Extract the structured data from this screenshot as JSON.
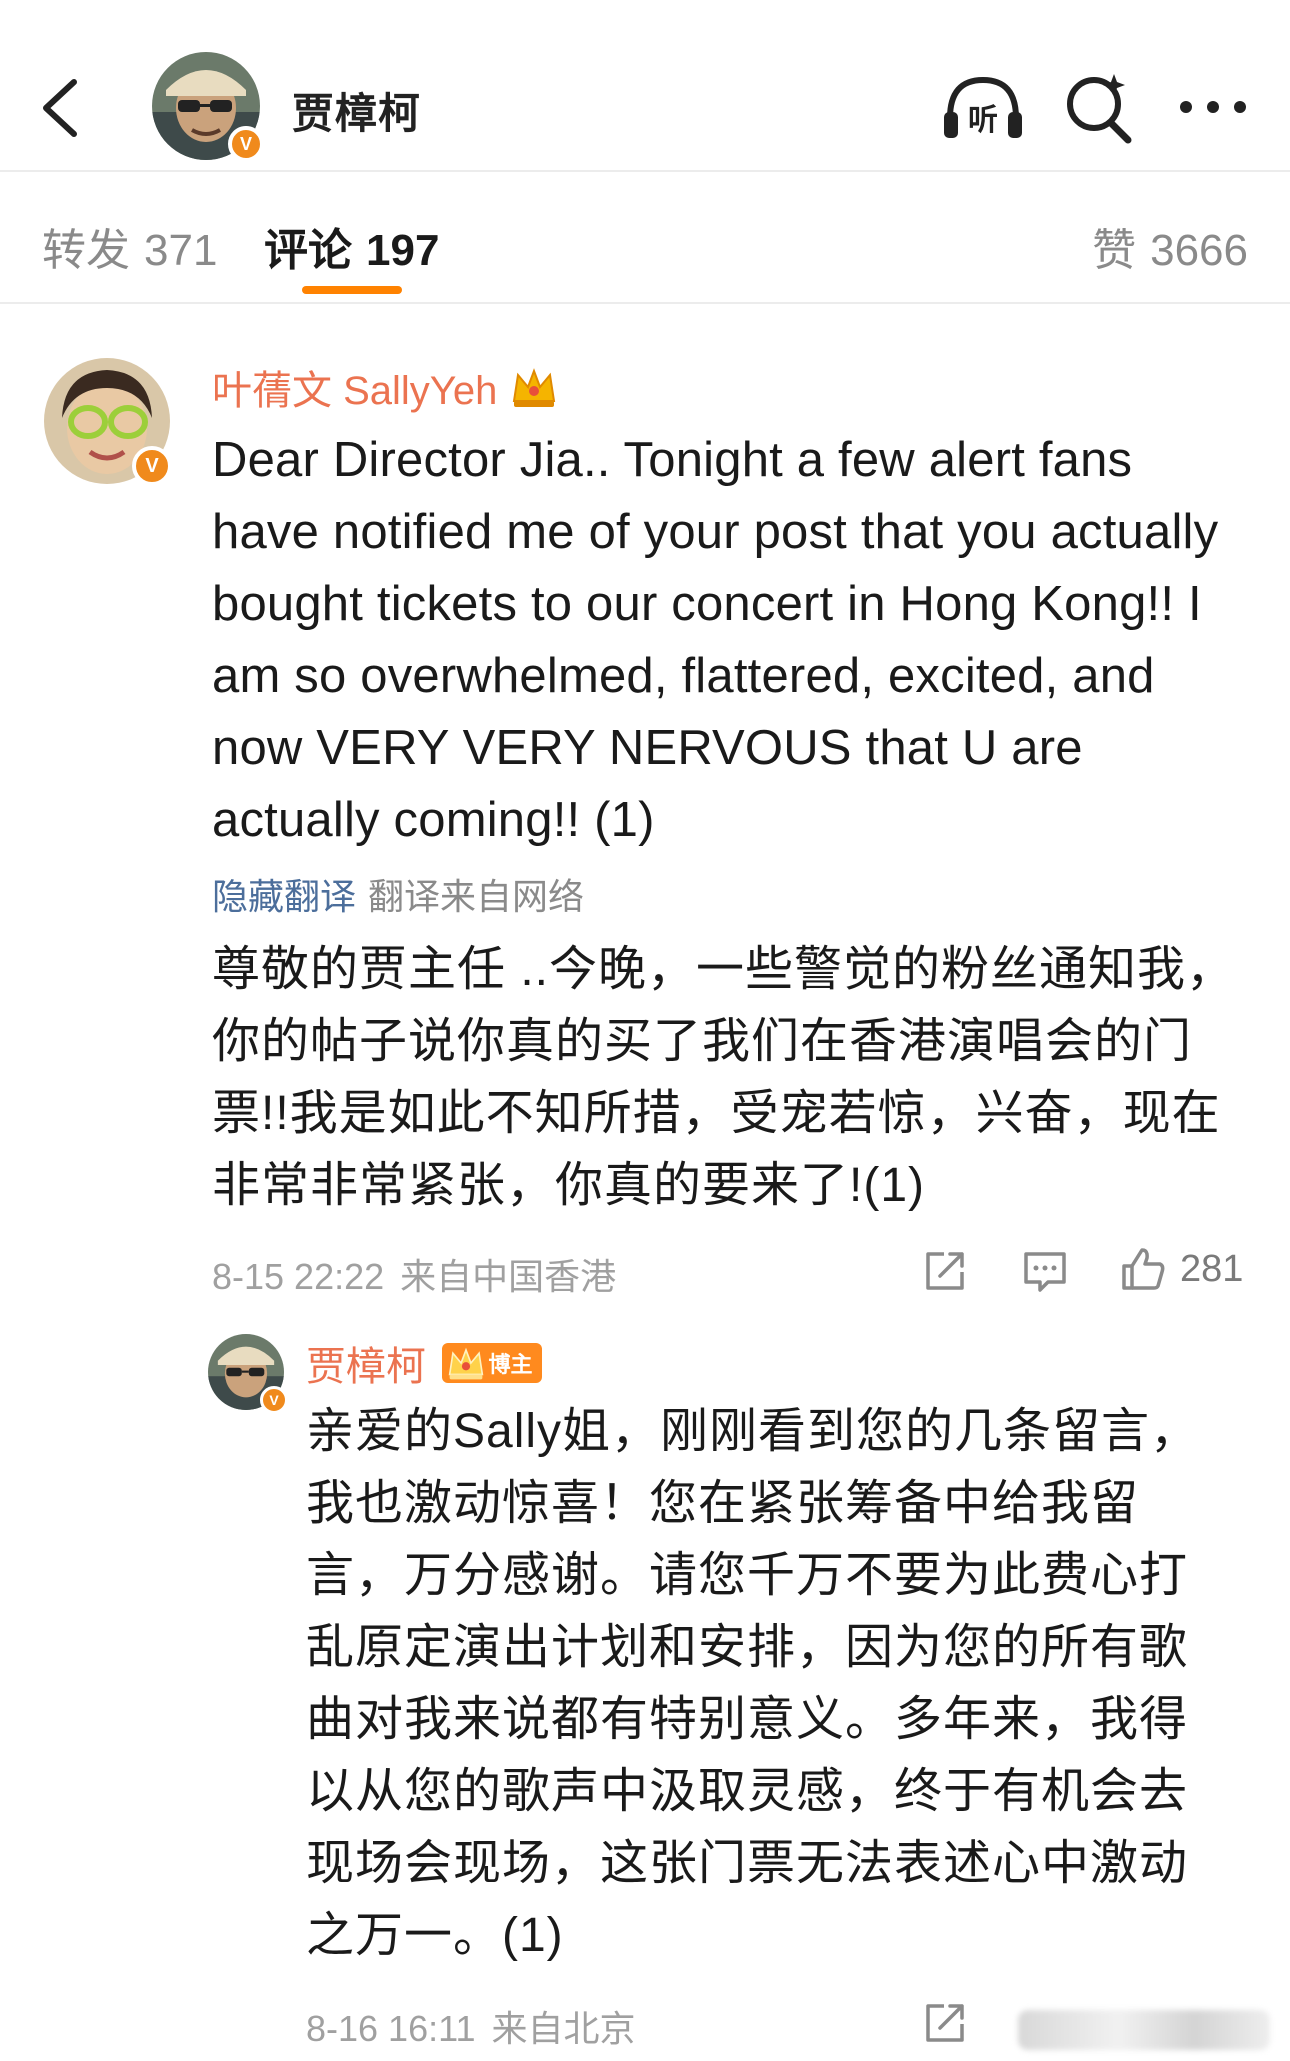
{
  "header": {
    "username": "贾樟柯",
    "verified_badge": "V",
    "icons": [
      "back-icon",
      "listen-icon",
      "search-icon",
      "more-icon"
    ],
    "listen_label": "听"
  },
  "tabs": [
    {
      "label": "转发",
      "count": "371",
      "active": false
    },
    {
      "label": "评论",
      "count": "197",
      "active": true
    },
    {
      "label": "赞",
      "count": "3666",
      "active": false
    }
  ],
  "colors": {
    "accent": "#ff8200",
    "username": "#eb7350",
    "link": "#4c6e9b",
    "meta": "#a0a0a0"
  },
  "comment": {
    "author": "叶蒨文 SallyYeh",
    "verified_badge": "V",
    "text": "Dear Director Jia.. Tonight a few alert fans have notified me of your post that you actually bought tickets to our concert in Hong Kong!!  I am so overwhelmed, flattered, excited, and now VERY VERY NERVOUS that U are actually coming!! (1)",
    "hide_translation": "隐藏翻译",
    "translation_source": "翻译来自网络",
    "translation": "尊敬的贾主任 ..今晚，一些警觉的粉丝通知我，你的帖子说你真的买了我们在香港演唱会的门票!!我是如此不知所措，受宠若惊，兴奋，现在非常非常紧张，你真的要来了!(1)",
    "time": "8-15 22:22",
    "location": "来自中国香港",
    "likes": "281"
  },
  "reply": {
    "author": "贾樟柯",
    "verified_badge": "V",
    "author_badge": "博主",
    "text": "亲爱的Sally姐，刚刚看到您的几条留言，我也激动惊喜！您在紧张筹备中给我留言，万分感谢。请您千万不要为此费心打乱原定演出计划和安排，因为您的所有歌曲对我来说都有特别意义。多年来，我得以从您的歌声中汲取灵感，终于有机会去现场会现场，这张门票无法表述心中激动之万一。(1)",
    "time": "8-16 16:11",
    "location": "来自北京"
  }
}
